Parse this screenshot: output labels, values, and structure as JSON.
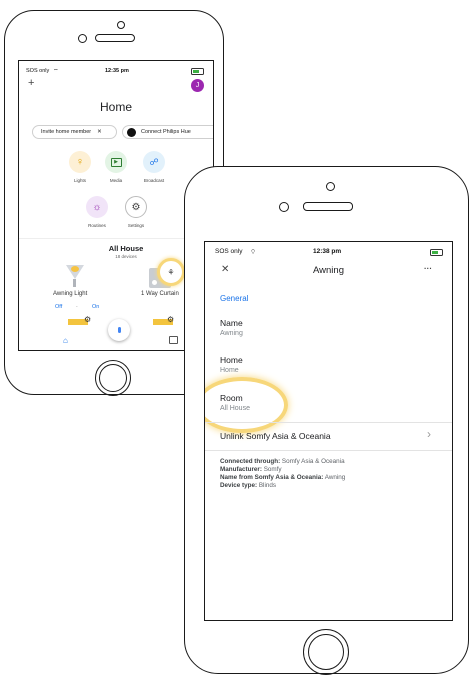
{
  "colors": {
    "accent_blue": "#1a73e8",
    "highlight_yellow": "#f7d77a",
    "avatar_purple": "#9c27b0",
    "lights_bg": "#fdf0d5",
    "media_bg": "#e3f4e5",
    "broadcast_bg": "#e2f1fb",
    "routines_bg": "#f1e4f8"
  },
  "back_phone": {
    "status": {
      "carrier": "SOS only",
      "time": "12:35 pm"
    },
    "add_icon": "+",
    "avatar_initial": "J",
    "title": "Home",
    "chips": [
      {
        "label": "Invite home member",
        "close": "✕"
      },
      {
        "label": "Connect Philips Hue"
      }
    ],
    "actions": [
      {
        "label": "Lights",
        "icon": "lightbulb-icon"
      },
      {
        "label": "Media",
        "icon": "media-icon"
      },
      {
        "label": "Broadcast",
        "icon": "broadcast-icon"
      },
      {
        "label": "Routines",
        "icon": "routines-icon"
      },
      {
        "label": "Settings",
        "icon": "settings-gear-icon"
      }
    ],
    "section_title": "All House",
    "section_subtitle": "18 devices",
    "devices": [
      {
        "name": "Awning Light",
        "off": "Off",
        "sep": "·",
        "on": "On"
      },
      {
        "name": "1 Way Curtain"
      }
    ]
  },
  "front_phone": {
    "status": {
      "carrier": "SOS only",
      "time": "12:38 pm"
    },
    "close_icon": "✕",
    "title": "Awning",
    "more_icon": "···",
    "section": "General",
    "rows": [
      {
        "label": "Name",
        "value": "Awning"
      },
      {
        "label": "Home",
        "value": "Home"
      },
      {
        "label": "Room",
        "value": "All House"
      }
    ],
    "unlink": {
      "label": "Unlink Somfy Asia & Oceania",
      "chevron": "›"
    },
    "details": [
      {
        "key": "Connected through:",
        "value": "Somfy Asia & Oceania"
      },
      {
        "key": "Manufacturer:",
        "value": "Somfy"
      },
      {
        "key": "Name from Somfy Asia & Oceania:",
        "value": "Awning"
      },
      {
        "key": "Device type:",
        "value": "Blinds"
      }
    ]
  }
}
